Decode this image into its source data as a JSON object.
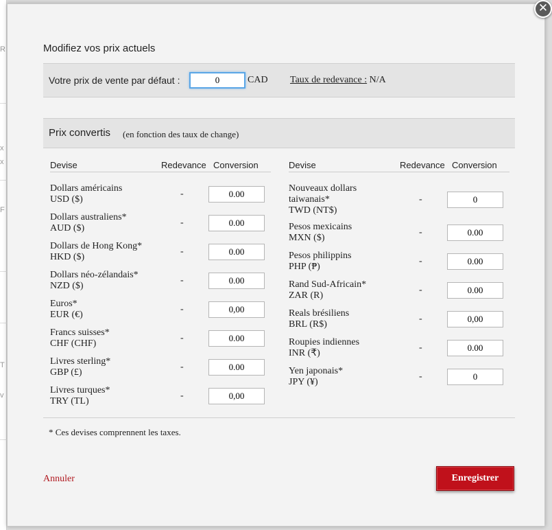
{
  "modal": {
    "close_symbol": "✕",
    "title": "Modifiez vos prix actuels"
  },
  "default_price": {
    "label": "Votre prix de vente par défaut :",
    "value": "0",
    "currency": "CAD",
    "royalty_label": "Taux de redevance :",
    "royalty_value": "N/A"
  },
  "converted": {
    "title": "Prix convertis",
    "subtitle": "(en fonction des taux de change)",
    "columns": {
      "devise": "Devise",
      "redevance": "Redevance",
      "conversion": "Conversion"
    },
    "left": [
      {
        "name": "Dollars américains",
        "code": "USD ($)",
        "royalty": "-",
        "value": "0.00"
      },
      {
        "name": "Dollars australiens*",
        "code": "AUD ($)",
        "royalty": "-",
        "value": "0.00"
      },
      {
        "name": "Dollars de Hong Kong*",
        "code": "HKD ($)",
        "royalty": "-",
        "value": "0.00"
      },
      {
        "name": "Dollars néo-zélandais*",
        "code": "NZD ($)",
        "royalty": "-",
        "value": "0.00"
      },
      {
        "name": "Euros*",
        "code": "EUR (€)",
        "royalty": "-",
        "value": "0,00"
      },
      {
        "name": "Francs suisses*",
        "code": "CHF (CHF)",
        "royalty": "-",
        "value": "0.00"
      },
      {
        "name": "Livres sterling*",
        "code": "GBP (£)",
        "royalty": "-",
        "value": "0.00"
      },
      {
        "name": "Livres turques*",
        "code": "TRY (TL)",
        "royalty": "-",
        "value": "0,00"
      }
    ],
    "right": [
      {
        "name": "Nouveaux dollars taiwanais*",
        "code": "TWD (NT$)",
        "royalty": "-",
        "value": "0"
      },
      {
        "name": "Pesos mexicains",
        "code": "MXN ($)",
        "royalty": "-",
        "value": "0.00"
      },
      {
        "name": "Pesos philippins",
        "code": "PHP (₱)",
        "royalty": "-",
        "value": "0.00"
      },
      {
        "name": "Rand Sud-Africain*",
        "code": "ZAR (R)",
        "royalty": "-",
        "value": "0.00"
      },
      {
        "name": "Reals brésiliens",
        "code": "BRL (R$)",
        "royalty": "-",
        "value": "0,00"
      },
      {
        "name": "Roupies indiennes",
        "code": "INR (₹)",
        "royalty": "-",
        "value": "0.00"
      },
      {
        "name": "Yen japonais*",
        "code": "JPY (¥)",
        "royalty": "-",
        "value": "0"
      }
    ],
    "footnote": "* Ces devises comprennent les taxes."
  },
  "actions": {
    "cancel": "Annuler",
    "save": "Enregistrer"
  },
  "colors": {
    "accent_red": "#c0111b",
    "focus_blue": "#5aa6e6"
  }
}
